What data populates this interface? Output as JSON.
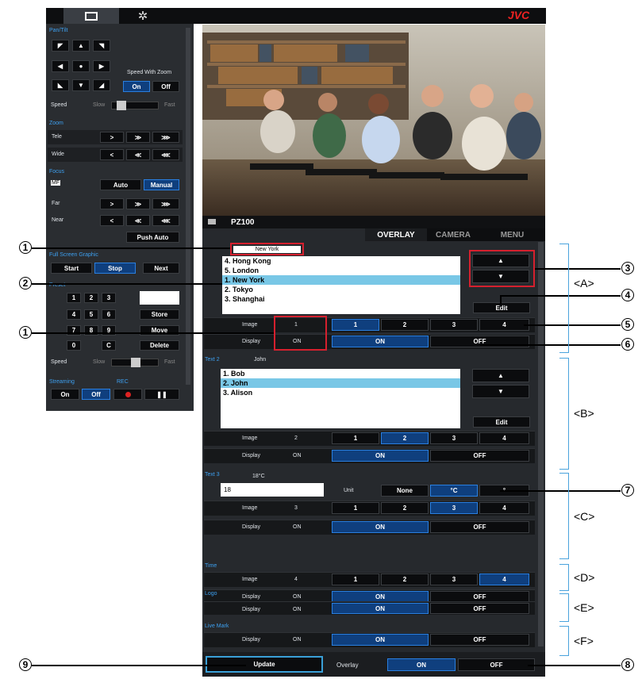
{
  "brand": "JVC",
  "tabs_top": {
    "monitor": "monitor-icon",
    "settings": "gear-icon"
  },
  "left_panel": {
    "pantilt": {
      "title": "Pan/Tilt",
      "speed_with_zoom": "Speed With Zoom",
      "on": "On",
      "off": "Off",
      "speed": "Speed",
      "slow": "Slow",
      "fast": "Fast"
    },
    "zoom": {
      "title": "Zoom",
      "tele": "Tele",
      "wide": "Wide"
    },
    "focus": {
      "title": "Focus",
      "mf": "MF",
      "auto": "Auto",
      "manual": "Manual",
      "far": "Far",
      "near": "Near",
      "push_auto": "Push Auto"
    },
    "fsg": {
      "title": "Full Screen Graphic",
      "start": "Start",
      "stop": "Stop",
      "next": "Next"
    },
    "preset": {
      "title": "Preset",
      "keys": [
        "1",
        "2",
        "3",
        "4",
        "5",
        "6",
        "7",
        "8",
        "9",
        "0",
        "C"
      ],
      "store": "Store",
      "move": "Move",
      "delete": "Delete",
      "speed": "Speed",
      "slow": "Slow",
      "fast": "Fast"
    },
    "streaming": {
      "title": "Streaming",
      "rec": "REC",
      "on": "On",
      "off": "Off"
    }
  },
  "camera_label": "PZ100",
  "main_tabs": [
    "OVERLAY",
    "CAMERA",
    "MENU"
  ],
  "text1": {
    "label": "New York",
    "items": [
      "4. Hong Kong",
      "5. London",
      "1. New York",
      "2. Tokyo",
      "3. Shanghai"
    ],
    "selected": 2,
    "edit": "Edit",
    "image_label": "Image",
    "image_value": "1",
    "display_label": "Display",
    "display_value": "ON"
  },
  "text2": {
    "title": "Text 2",
    "value": "John",
    "items": [
      "1. Bob",
      "2. John",
      "3. Alison"
    ],
    "selected": 1,
    "edit": "Edit",
    "image_label": "Image",
    "image_value": "2",
    "display_label": "Display",
    "display_value": "ON"
  },
  "text3": {
    "title": "Text 3",
    "value": "18°C",
    "input": "18",
    "unit_label": "Unit",
    "units": [
      "None",
      "°C",
      "°"
    ],
    "image_label": "Image",
    "image_value": "3",
    "display_label": "Display",
    "display_value": "ON"
  },
  "time": {
    "title": "Time",
    "image_label": "Image",
    "image_value": "4",
    "display_label": "Display",
    "display_value": "ON"
  },
  "logo": {
    "title": "Logo",
    "display_label": "Display",
    "display_value": "ON"
  },
  "livemark": {
    "title": "Live Mark",
    "display_label": "Display",
    "display_value": "ON"
  },
  "image_options": [
    "1",
    "2",
    "3",
    "4"
  ],
  "on_off": [
    "ON",
    "OFF"
  ],
  "bottom": {
    "update": "Update",
    "overlay": "Overlay",
    "on": "ON",
    "off": "OFF"
  },
  "callouts": {
    "c1": "1",
    "c2": "2",
    "c3": "3",
    "c4": "4",
    "c5": "5",
    "c6": "6",
    "c7": "7",
    "c8": "8",
    "c9": "9"
  },
  "groups": [
    "<A>",
    "<B>",
    "<C>",
    "<D>",
    "<E>",
    "<F>"
  ]
}
